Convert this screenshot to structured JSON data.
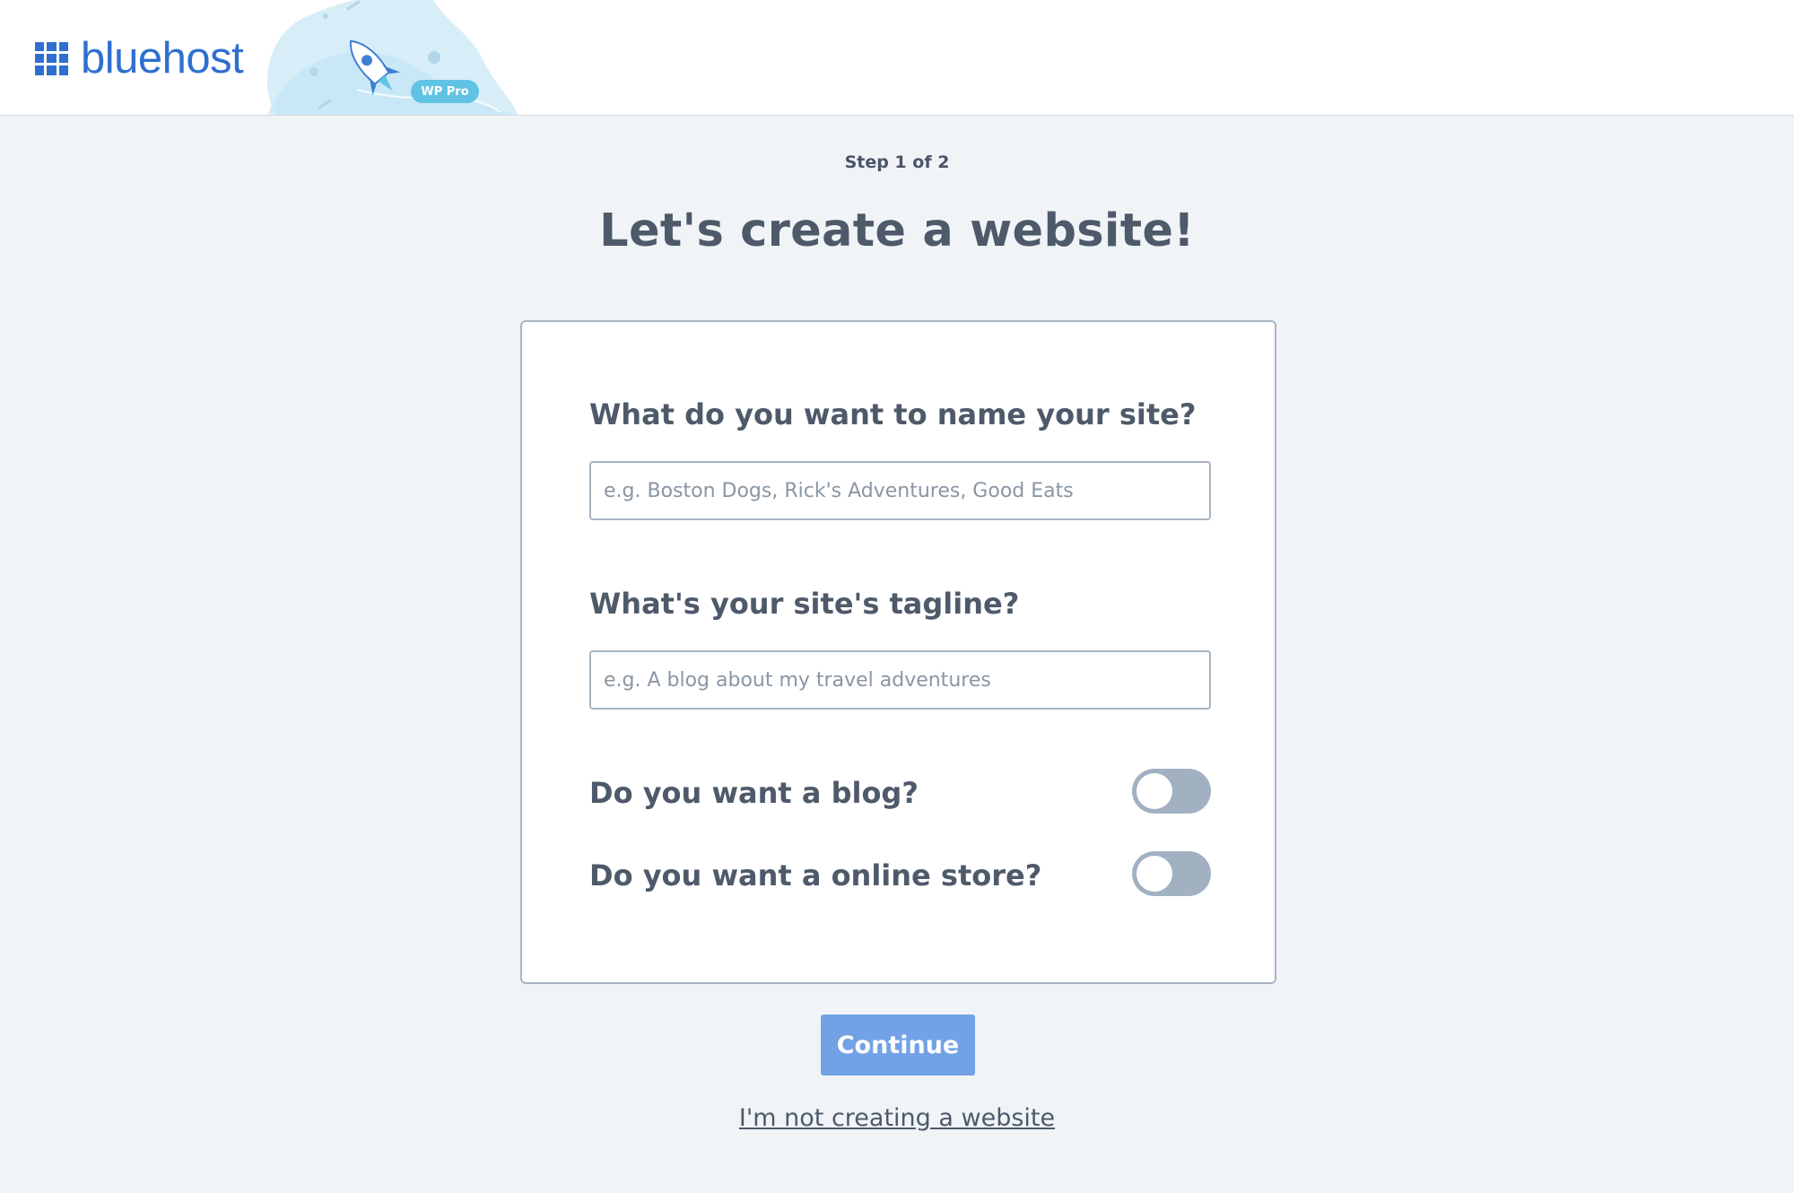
{
  "header": {
    "brand": "bluehost",
    "badge": "WP Pro",
    "accent_color": "#2f6fd0",
    "logo_icon": "grid-icon",
    "illustration_icon": "rocket-icon"
  },
  "main": {
    "step_label": "Step 1 of 2",
    "title": "Let's create a website!"
  },
  "form": {
    "site_name": {
      "label": "What do you want to name your site?",
      "placeholder": "e.g. Boston Dogs, Rick's Adventures, Good Eats",
      "value": ""
    },
    "tagline": {
      "label": "What's your site's tagline?",
      "placeholder": "e.g. A blog about my travel adventures",
      "value": ""
    },
    "blog_toggle": {
      "label": "Do you want a blog?",
      "on": false
    },
    "store_toggle": {
      "label": "Do you want a online store?",
      "on": false
    }
  },
  "actions": {
    "continue_label": "Continue",
    "skip_label": "I'm not creating a website",
    "button_color": "#72a2e5"
  }
}
